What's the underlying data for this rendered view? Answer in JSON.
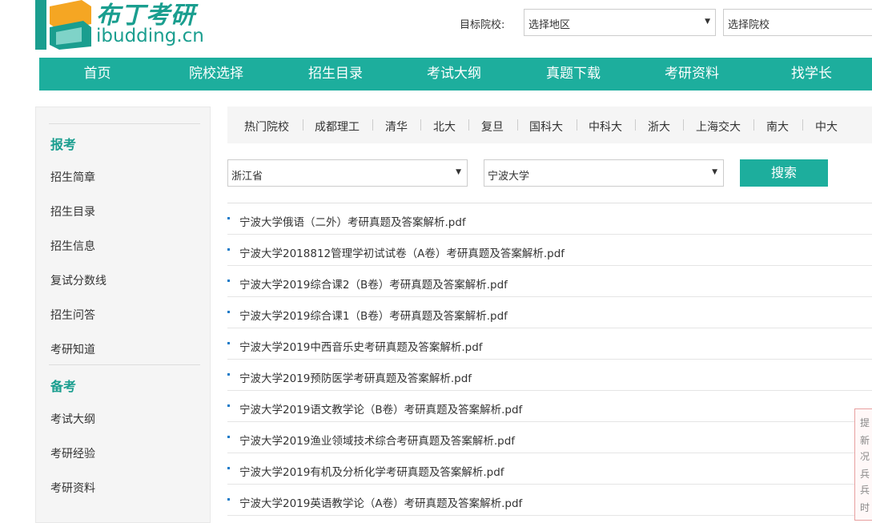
{
  "header": {
    "logo_text": "布丁考研",
    "logo_domain": "ibudding.cn",
    "target_label": "目标院校:",
    "region_select": "选择地区",
    "school_select": "选择院校"
  },
  "nav": [
    "首页",
    "院校选择",
    "招生目录",
    "考试大纲",
    "真题下载",
    "考研资料",
    "找学长"
  ],
  "sidebar": {
    "section1": "报考",
    "section1_items": [
      "招生简章",
      "招生目录",
      "招生信息",
      "复试分数线",
      "招生问答",
      "考研知道"
    ],
    "section2": "备考",
    "section2_items": [
      "考试大纲",
      "考研经验",
      "考研资料"
    ]
  },
  "hot_schools": [
    "热门院校",
    "成都理工",
    "清华",
    "北大",
    "复旦",
    "国科大",
    "中科大",
    "浙大",
    "上海交大",
    "南大",
    "中大"
  ],
  "filters": {
    "province": "浙江省",
    "university": "宁波大学",
    "search_label": "搜索"
  },
  "files": [
    "宁波大学俄语（二外）考研真题及答案解析.pdf",
    "宁波大学2018812管理学初试试卷（A卷）考研真题及答案解析.pdf",
    "宁波大学2019综合课2（B卷）考研真题及答案解析.pdf",
    "宁波大学2019综合课1（B卷）考研真题及答案解析.pdf",
    "宁波大学2019中西音乐史考研真题及答案解析.pdf",
    "宁波大学2019预防医学考研真题及答案解析.pdf",
    "宁波大学2019语文教学论（B卷）考研真题及答案解析.pdf",
    "宁波大学2019渔业领域技术综合考研真题及答案解析.pdf",
    "宁波大学2019有机及分析化学考研真题及答案解析.pdf",
    "宁波大学2019英语教学论（A卷）考研真题及答案解析.pdf"
  ],
  "notice": [
    "提",
    "新",
    "况",
    "兵",
    "兵",
    "时"
  ],
  "colors": {
    "brand": "#1dae9d",
    "brand_text": "#1a9e8f",
    "bullet": "#1a7bc8"
  }
}
